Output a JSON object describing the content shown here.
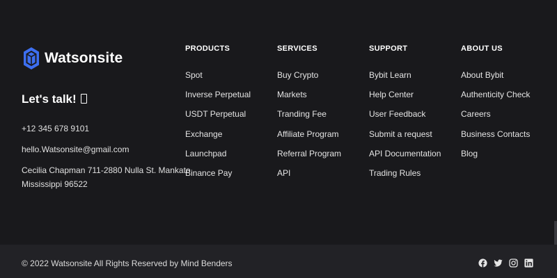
{
  "brand": {
    "name": "Watsonsite",
    "tagline": "Let's talk!",
    "phone": "+12 345 678 9101",
    "email": "hello.Watsonsite@gmail.com",
    "address_line1": "Cecilia Chapman 711-2880 Nulla St. Mankato",
    "address_line2": "Mississippi 96522",
    "accent_color": "#3d6ff0"
  },
  "columns": [
    {
      "title": "PRODUCTS",
      "items": [
        "Spot",
        "Inverse Perpetual",
        "USDT Perpetual",
        "Exchange",
        "Launchpad",
        "Binance Pay"
      ]
    },
    {
      "title": "SERVICES",
      "items": [
        "Buy Crypto",
        "Markets",
        "Tranding Fee",
        "Affiliate Program",
        "Referral Program",
        "API"
      ]
    },
    {
      "title": "SUPPORT",
      "items": [
        "Bybit Learn",
        "Help Center",
        "User Feedback",
        "Submit a request",
        "API Documentation",
        "Trading Rules"
      ]
    },
    {
      "title": "ABOUT US",
      "items": [
        "About Bybit",
        "Authenticity Check",
        "Careers",
        "Business Contacts",
        "Blog"
      ]
    }
  ],
  "bottom": {
    "copyright": "© 2022 Watsonsite All Rights Reserved by Mind Benders",
    "socials": [
      "facebook-icon",
      "twitter-icon",
      "instagram-icon",
      "linkedin-icon"
    ]
  }
}
